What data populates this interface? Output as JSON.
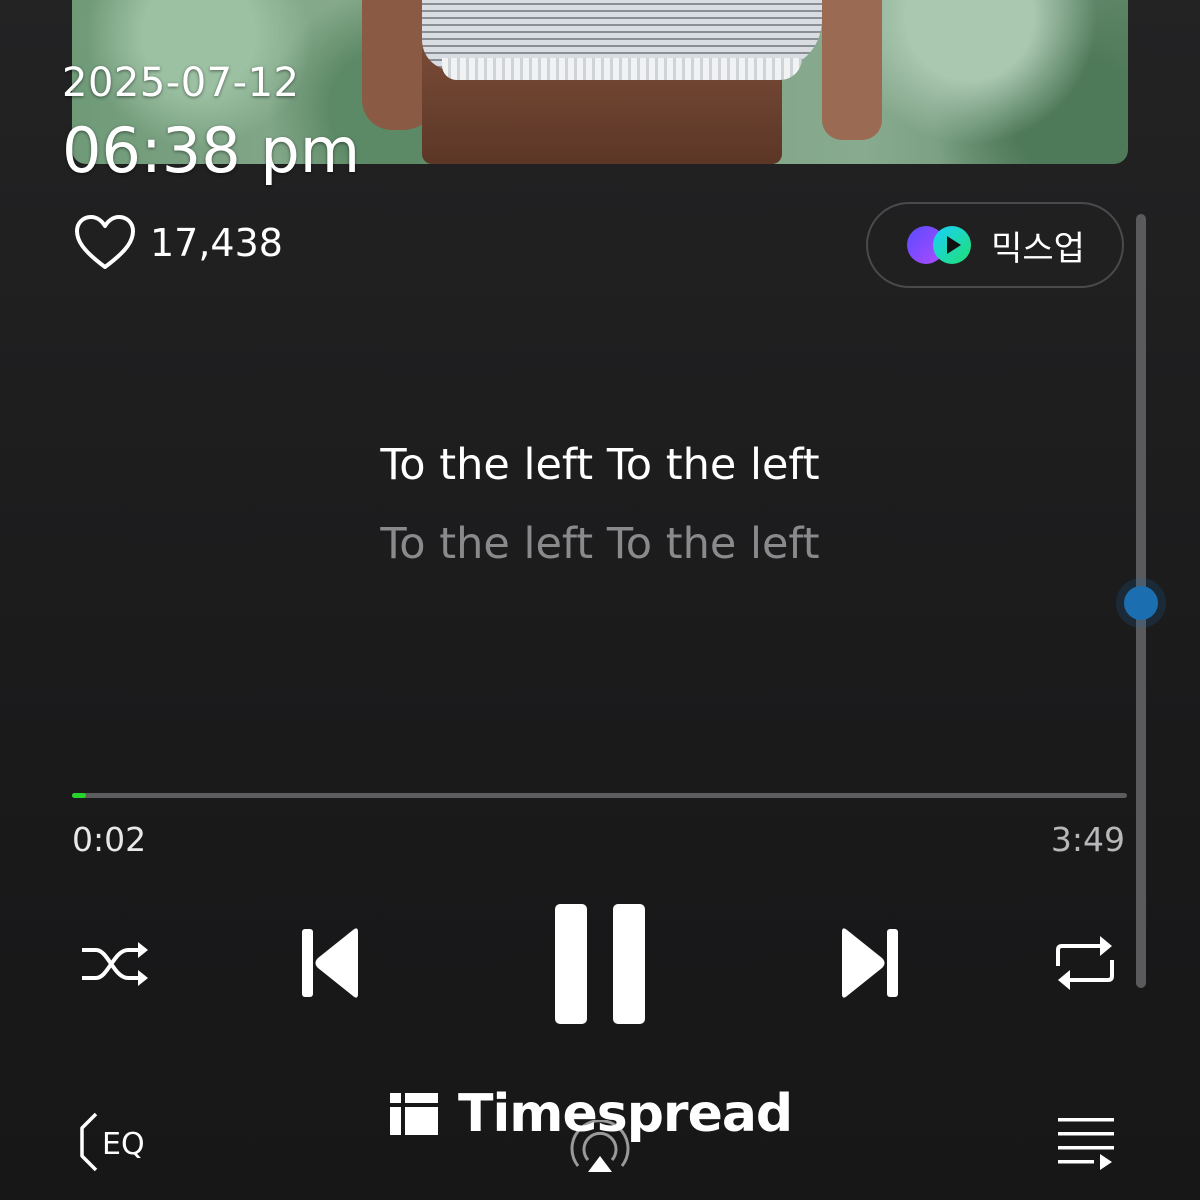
{
  "status": {
    "date": "2025-07-12",
    "time": "06:38 pm"
  },
  "player": {
    "like_count": "17,438",
    "mixup_label": "믹스업",
    "lyrics": [
      "To the left To the left",
      "To the left To the left"
    ],
    "current_time": "0:02",
    "total_time": "3:49",
    "progress_fraction": 0.009,
    "accent_color": "#26d32a"
  },
  "controls": {
    "shuffle": "shuffle-icon",
    "previous": "skip-previous-icon",
    "play_pause": "pause-icon",
    "next": "skip-next-icon",
    "repeat": "repeat-icon",
    "eq": "eq-icon",
    "cast": "cast-icon",
    "queue": "playlist-icon"
  },
  "watermark": {
    "text": "Timespread"
  }
}
